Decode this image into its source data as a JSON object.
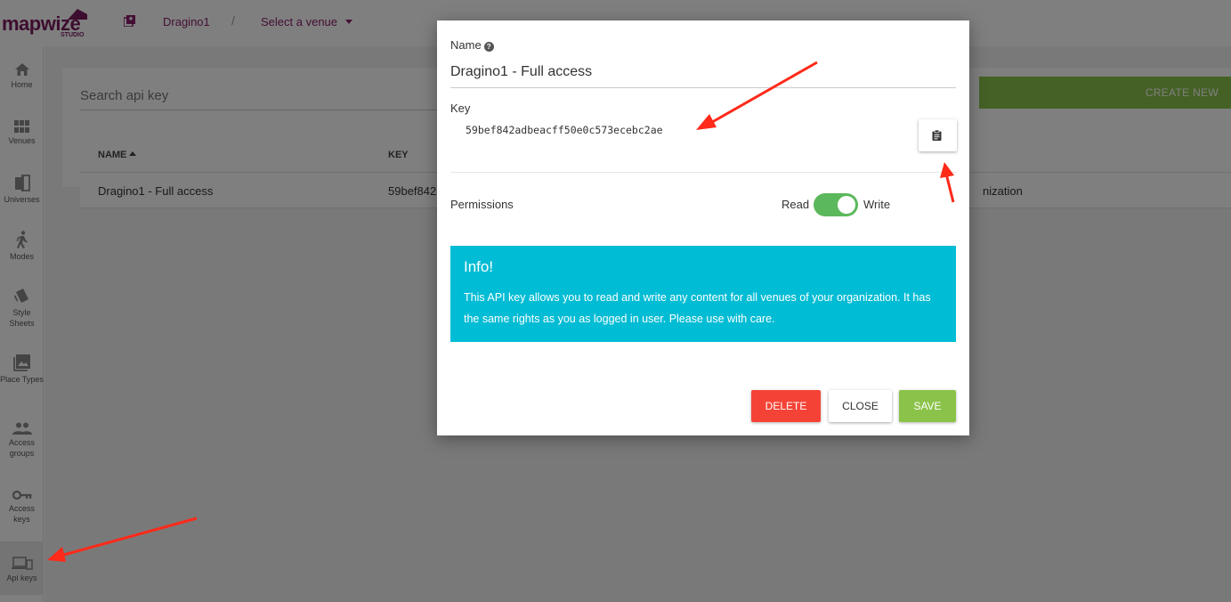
{
  "app": {
    "logo_text": "mapwize",
    "logo_sub": "STUDIO",
    "organization": "Dragino1",
    "breadcrumb_separator": "/",
    "venue_select": "Select a venue"
  },
  "sidebar": {
    "items": [
      {
        "label": "Home",
        "icon": "home-icon"
      },
      {
        "label": "Venues",
        "icon": "grid-icon"
      },
      {
        "label": "Universes",
        "icon": "universe-icon"
      },
      {
        "label": "Modes",
        "icon": "walk-icon"
      },
      {
        "label": "Style Sheets",
        "icon": "style-icon"
      },
      {
        "label": "Place Types",
        "icon": "image-icon"
      },
      {
        "label": "Access groups",
        "icon": "people-icon"
      },
      {
        "label": "Access keys",
        "icon": "key-icon"
      },
      {
        "label": "Api keys",
        "icon": "devices-icon"
      }
    ]
  },
  "main": {
    "search_placeholder": "Search api key",
    "create_label": "CREATE NEW",
    "columns": {
      "name": "NAME",
      "key": "KEY"
    },
    "rows": [
      {
        "name": "Dragino1 - Full access",
        "key": "59bef842",
        "org_fragment": "nization"
      }
    ]
  },
  "modal": {
    "name_label": "Name",
    "name_value": "Dragino1 - Full access",
    "key_label": "Key",
    "key_value": "59bef842adbeacff50e0c573ecebc2ae",
    "permissions_label": "Permissions",
    "read_label": "Read",
    "write_label": "Write",
    "write_enabled": true,
    "info_title": "Info!",
    "info_text": "This API key allows you to read and write any content for all venues of your organization. It has the same rights as you as logged in user. Please use with care.",
    "delete_label": "DELETE",
    "close_label": "CLOSE",
    "save_label": "SAVE"
  },
  "colors": {
    "brand": "#7b1a5e",
    "accent_green": "#8bc34a",
    "info": "#00bcd4",
    "danger": "#f44336",
    "toggle_on": "#5cb85c",
    "annotation": "#ff2a1a"
  }
}
